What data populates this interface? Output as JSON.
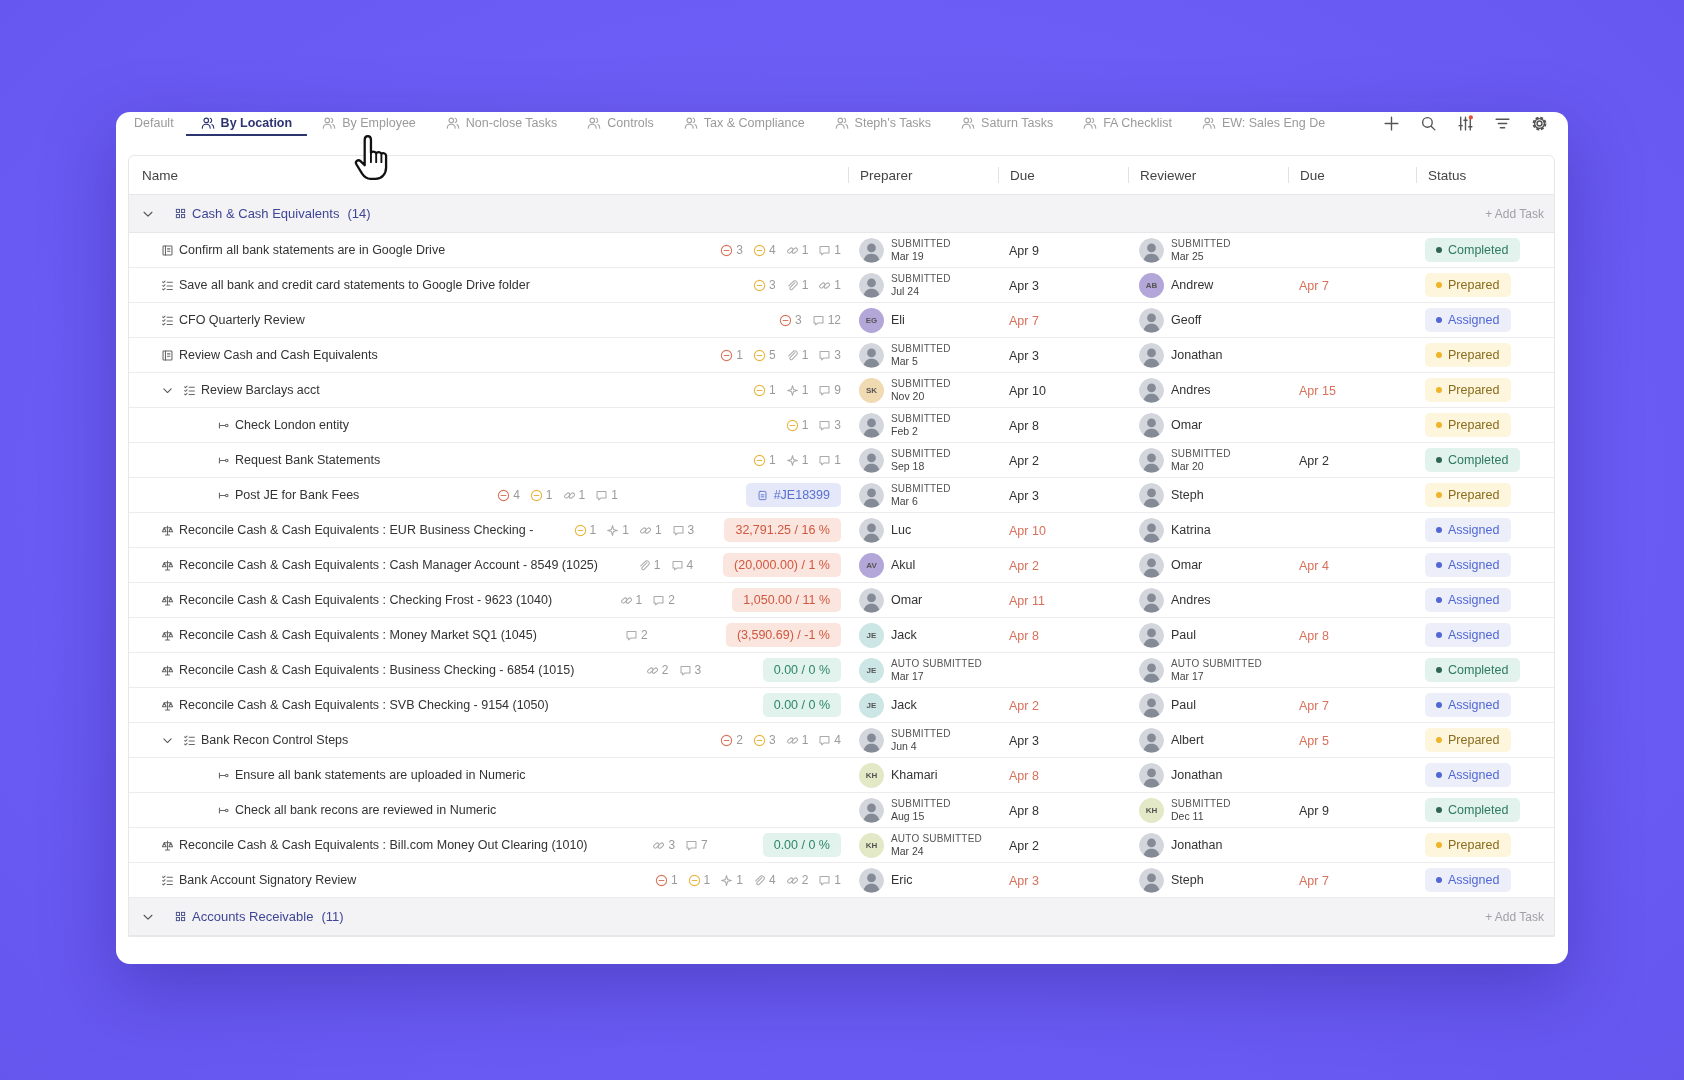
{
  "tabs": [
    {
      "label": "Default",
      "kind": "plain",
      "selected": false
    },
    {
      "label": "By Location",
      "kind": "grouped",
      "selected": true
    },
    {
      "label": "By Employee",
      "kind": "grouped",
      "selected": false
    },
    {
      "label": "Non-close Tasks",
      "kind": "grouped",
      "selected": false
    },
    {
      "label": "Controls",
      "kind": "grouped",
      "selected": false
    },
    {
      "label": "Tax & Compliance",
      "kind": "grouped",
      "selected": false
    },
    {
      "label": "Steph's Tasks",
      "kind": "grouped",
      "selected": false
    },
    {
      "label": "Saturn Tasks",
      "kind": "grouped",
      "selected": false
    },
    {
      "label": "FA Checklist",
      "kind": "grouped",
      "selected": false
    },
    {
      "label": "EW: Sales Eng De",
      "kind": "grouped",
      "selected": false
    }
  ],
  "table": {
    "columns": [
      "Name",
      "Preparer",
      "Due",
      "Reviewer",
      "Due",
      "Status"
    ],
    "groups": [
      {
        "name": "Cash & Cash Equivalents",
        "count": "(14)",
        "expanded": true,
        "add_label": "+ Add Task",
        "rows": [
          {
            "kind": "document",
            "name": "Confirm all bank statements are in Google Drive",
            "badges": [
              {
                "kind": "blocker",
                "count": "3"
              },
              {
                "kind": "warning",
                "count": "4"
              },
              {
                "kind": "link",
                "count": "1"
              },
              {
                "kind": "comment",
                "count": "1"
              }
            ],
            "preparer": {
              "avatar": {
                "kind": "photo"
              },
              "note": "SUBMITTED",
              "date": "Mar 19"
            },
            "preparer_due": {
              "text": "Apr 9",
              "overdue": false
            },
            "reviewer": {
              "avatar": {
                "kind": "photo"
              },
              "note": "SUBMITTED",
              "date": "Mar 25"
            },
            "status": {
              "kind": "completed",
              "label": "Completed"
            }
          },
          {
            "kind": "checklist",
            "name": "Save all bank and credit card statements to Google Drive folder",
            "badges": [
              {
                "kind": "warning",
                "count": "3"
              },
              {
                "kind": "attachment",
                "count": "1"
              },
              {
                "kind": "link",
                "count": "1"
              }
            ],
            "preparer": {
              "avatar": {
                "kind": "photo"
              },
              "note": "SUBMITTED",
              "date": "Jul 24"
            },
            "preparer_due": {
              "text": "Apr 3",
              "overdue": false
            },
            "reviewer": {
              "avatar": {
                "kind": "initials",
                "initials": "AB",
                "color": "#b3a6d8"
              },
              "name": "Andrew"
            },
            "reviewer_due": {
              "text": "Apr 7",
              "overdue": true
            },
            "status": {
              "kind": "prepared",
              "label": "Prepared"
            }
          },
          {
            "kind": "checklist",
            "name": "CFO Quarterly Review",
            "badges": [
              {
                "kind": "blocker",
                "count": "3"
              },
              {
                "kind": "comment",
                "count": "12"
              }
            ],
            "preparer": {
              "avatar": {
                "kind": "initials",
                "initials": "EG",
                "color": "#b3a6d8"
              },
              "name": "Eli"
            },
            "preparer_due": {
              "text": "Apr 7",
              "overdue": true
            },
            "reviewer": {
              "avatar": {
                "kind": "photo"
              },
              "name": "Geoff"
            },
            "status": {
              "kind": "assigned",
              "label": "Assigned"
            }
          },
          {
            "kind": "document",
            "name": "Review Cash and Cash Equivalents",
            "badges": [
              {
                "kind": "blocker",
                "count": "1"
              },
              {
                "kind": "warning",
                "count": "5"
              },
              {
                "kind": "attachment",
                "count": "1"
              },
              {
                "kind": "comment",
                "count": "3"
              }
            ],
            "preparer": {
              "avatar": {
                "kind": "photo"
              },
              "note": "SUBMITTED",
              "date": "Mar 5"
            },
            "preparer_due": {
              "text": "Apr 3",
              "overdue": false
            },
            "reviewer": {
              "avatar": {
                "kind": "photo"
              },
              "name": "Jonathan"
            },
            "status": {
              "kind": "prepared",
              "label": "Prepared"
            }
          },
          {
            "kind": "checklist",
            "expanded": true,
            "name": "Review Barclays acct",
            "badges": [
              {
                "kind": "warning",
                "count": "1"
              },
              {
                "kind": "spark",
                "count": "1"
              },
              {
                "kind": "comment",
                "count": "9"
              }
            ],
            "preparer": {
              "avatar": {
                "kind": "initials",
                "initials": "SK",
                "color": "#f0dab2"
              },
              "note": "SUBMITTED",
              "date": "Nov 20"
            },
            "preparer_due": {
              "text": "Apr 10",
              "overdue": false
            },
            "reviewer": {
              "avatar": {
                "kind": "photo"
              },
              "name": "Andres"
            },
            "reviewer_due": {
              "text": "Apr 15",
              "overdue": true
            },
            "status": {
              "kind": "prepared",
              "label": "Prepared"
            },
            "children": [
              {
                "kind": "step",
                "name": "Check London entity",
                "badges": [
                  {
                    "kind": "warning",
                    "count": "1"
                  },
                  {
                    "kind": "comment",
                    "count": "3"
                  }
                ],
                "preparer": {
                  "avatar": {
                    "kind": "photo"
                  },
                  "note": "SUBMITTED",
                  "date": "Feb 2"
                },
                "preparer_due": {
                  "text": "Apr 8",
                  "overdue": false
                },
                "reviewer": {
                  "avatar": {
                    "kind": "photo"
                  },
                  "name": "Omar"
                },
                "status": {
                  "kind": "prepared",
                  "label": "Prepared"
                }
              },
              {
                "kind": "step",
                "name": "Request Bank Statements",
                "badges": [
                  {
                    "kind": "warning",
                    "count": "1"
                  },
                  {
                    "kind": "spark",
                    "count": "1"
                  },
                  {
                    "kind": "comment",
                    "count": "1"
                  }
                ],
                "preparer": {
                  "avatar": {
                    "kind": "photo"
                  },
                  "note": "SUBMITTED",
                  "date": "Sep 18"
                },
                "preparer_due": {
                  "text": "Apr 2",
                  "overdue": false
                },
                "reviewer": {
                  "avatar": {
                    "kind": "photo"
                  },
                  "note": "SUBMITTED",
                  "date": "Mar 20"
                },
                "reviewer_due": {
                  "text": "Apr 2",
                  "overdue": false
                },
                "status": {
                  "kind": "completed",
                  "label": "Completed"
                }
              },
              {
                "kind": "step",
                "name": "Post JE for Bank Fees",
                "badges": [
                  {
                    "kind": "blocker",
                    "count": "4"
                  },
                  {
                    "kind": "warning",
                    "count": "1"
                  },
                  {
                    "kind": "link",
                    "count": "1"
                  },
                  {
                    "kind": "comment",
                    "count": "1"
                  }
                ],
                "amount": {
                  "kind": "journal",
                  "text": "#JE18399"
                },
                "preparer": {
                  "avatar": {
                    "kind": "photo"
                  },
                  "note": "SUBMITTED",
                  "date": "Mar 6"
                },
                "preparer_due": {
                  "text": "Apr 3",
                  "overdue": false
                },
                "reviewer": {
                  "avatar": {
                    "kind": "photo"
                  },
                  "name": "Steph"
                },
                "status": {
                  "kind": "prepared",
                  "label": "Prepared"
                }
              }
            ]
          },
          {
            "kind": "reconciliation",
            "name": "Reconcile Cash & Cash Equivalents : EUR Business Checking -",
            "badges": [
              {
                "kind": "warning",
                "count": "1"
              },
              {
                "kind": "spark",
                "count": "1"
              },
              {
                "kind": "link",
                "count": "1"
              },
              {
                "kind": "comment",
                "count": "3"
              }
            ],
            "amount": {
              "kind": "variance",
              "text": "32,791.25 / 16 %"
            },
            "preparer": {
              "avatar": {
                "kind": "photo"
              },
              "name": "Luc"
            },
            "preparer_due": {
              "text": "Apr 10",
              "overdue": true
            },
            "reviewer": {
              "avatar": {
                "kind": "photo"
              },
              "name": "Katrina"
            },
            "status": {
              "kind": "assigned",
              "label": "Assigned"
            }
          },
          {
            "kind": "reconciliation",
            "name": "Reconcile Cash & Cash Equivalents : Cash Manager Account - 8549 (1025)",
            "badges": [
              {
                "kind": "attachment",
                "count": "1"
              },
              {
                "kind": "comment",
                "count": "4"
              }
            ],
            "amount": {
              "kind": "variance",
              "text": "(20,000.00) / 1 %"
            },
            "preparer": {
              "avatar": {
                "kind": "initials",
                "initials": "AV",
                "color": "#b3a6d8"
              },
              "name": "Akul"
            },
            "preparer_due": {
              "text": "Apr 2",
              "overdue": true
            },
            "reviewer": {
              "avatar": {
                "kind": "photo"
              },
              "name": "Omar"
            },
            "reviewer_due": {
              "text": "Apr 4",
              "overdue": true
            },
            "status": {
              "kind": "assigned",
              "label": "Assigned"
            }
          },
          {
            "kind": "reconciliation",
            "name": "Reconcile Cash & Cash Equivalents : Checking Frost - 9623 (1040)",
            "badges": [
              {
                "kind": "link",
                "count": "1"
              },
              {
                "kind": "comment",
                "count": "2"
              }
            ],
            "amount": {
              "kind": "variance",
              "text": "1,050.00 / 11 %"
            },
            "preparer": {
              "avatar": {
                "kind": "photo"
              },
              "name": "Omar"
            },
            "preparer_due": {
              "text": "Apr 11",
              "overdue": true
            },
            "reviewer": {
              "avatar": {
                "kind": "photo"
              },
              "name": "Andres"
            },
            "status": {
              "kind": "assigned",
              "label": "Assigned"
            }
          },
          {
            "kind": "reconciliation",
            "name": "Reconcile Cash & Cash Equivalents : Money Market SQ1 (1045)",
            "badges": [
              {
                "kind": "comment",
                "count": "2"
              }
            ],
            "amount": {
              "kind": "variance",
              "text": "(3,590.69) / -1 %"
            },
            "preparer": {
              "avatar": {
                "kind": "initials",
                "initials": "JE",
                "color": "#cbe6e4"
              },
              "name": "Jack"
            },
            "preparer_due": {
              "text": "Apr 8",
              "overdue": true
            },
            "reviewer": {
              "avatar": {
                "kind": "photo"
              },
              "name": "Paul"
            },
            "reviewer_due": {
              "text": "Apr 8",
              "overdue": true
            },
            "status": {
              "kind": "assigned",
              "label": "Assigned"
            }
          },
          {
            "kind": "reconciliation",
            "name": "Reconcile Cash & Cash Equivalents : Business Checking - 6854 (1015)",
            "badges": [
              {
                "kind": "link",
                "count": "2"
              },
              {
                "kind": "comment",
                "count": "3"
              }
            ],
            "amount": {
              "kind": "balanced",
              "text": "0.00 / 0 %"
            },
            "preparer": {
              "avatar": {
                "kind": "initials",
                "initials": "JE",
                "color": "#cbe6e4"
              },
              "note": "AUTO SUBMITTED",
              "date": "Mar 17"
            },
            "reviewer": {
              "avatar": {
                "kind": "photo"
              },
              "note": "AUTO SUBMITTED",
              "date": "Mar 17"
            },
            "status": {
              "kind": "completed",
              "label": "Completed"
            }
          },
          {
            "kind": "reconciliation",
            "name": "Reconcile Cash & Cash Equivalents : SVB Checking - 9154 (1050)",
            "amount": {
              "kind": "balanced",
              "text": "0.00 / 0 %"
            },
            "preparer": {
              "avatar": {
                "kind": "initials",
                "initials": "JE",
                "color": "#cbe6e4"
              },
              "name": "Jack"
            },
            "preparer_due": {
              "text": "Apr 2",
              "overdue": true
            },
            "reviewer": {
              "avatar": {
                "kind": "photo"
              },
              "name": "Paul"
            },
            "reviewer_due": {
              "text": "Apr 7",
              "overdue": true
            },
            "status": {
              "kind": "assigned",
              "label": "Assigned"
            }
          },
          {
            "kind": "checklist",
            "expanded": true,
            "name": "Bank Recon Control Steps",
            "badges": [
              {
                "kind": "blocker",
                "count": "2"
              },
              {
                "kind": "warning",
                "count": "3"
              },
              {
                "kind": "link",
                "count": "1"
              },
              {
                "kind": "comment",
                "count": "4"
              }
            ],
            "preparer": {
              "avatar": {
                "kind": "photo"
              },
              "note": "SUBMITTED",
              "date": "Jun 4"
            },
            "preparer_due": {
              "text": "Apr 3",
              "overdue": false
            },
            "reviewer": {
              "avatar": {
                "kind": "photo"
              },
              "name": "Albert"
            },
            "reviewer_due": {
              "text": "Apr 5",
              "overdue": true
            },
            "status": {
              "kind": "prepared",
              "label": "Prepared"
            },
            "children": [
              {
                "kind": "step",
                "name": "Ensure all bank statements are uploaded in Numeric",
                "preparer": {
                  "avatar": {
                    "kind": "initials",
                    "initials": "KH",
                    "color": "#e3e8c6"
                  },
                  "name": "Khamari"
                },
                "preparer_due": {
                  "text": "Apr 8",
                  "overdue": true
                },
                "reviewer": {
                  "avatar": {
                    "kind": "photo"
                  },
                  "name": "Jonathan"
                },
                "status": {
                  "kind": "assigned",
                  "label": "Assigned"
                }
              },
              {
                "kind": "step",
                "name": "Check all bank recons are reviewed in Numeric",
                "preparer": {
                  "avatar": {
                    "kind": "photo"
                  },
                  "note": "SUBMITTED",
                  "date": "Aug 15"
                },
                "preparer_due": {
                  "text": "Apr 8",
                  "overdue": false
                },
                "reviewer": {
                  "avatar": {
                    "kind": "initials",
                    "initials": "KH",
                    "color": "#e3e8c6"
                  },
                  "note": "SUBMITTED",
                  "date": "Dec 11"
                },
                "reviewer_due": {
                  "text": "Apr 9",
                  "overdue": false
                },
                "status": {
                  "kind": "completed",
                  "label": "Completed"
                }
              }
            ]
          },
          {
            "kind": "reconciliation",
            "name": "Reconcile Cash & Cash Equivalents : Bill.com Money Out Clearing (1010)",
            "badges": [
              {
                "kind": "link",
                "count": "3"
              },
              {
                "kind": "comment",
                "count": "7"
              }
            ],
            "amount": {
              "kind": "balanced",
              "text": "0.00 / 0 %"
            },
            "preparer": {
              "avatar": {
                "kind": "initials",
                "initials": "KH",
                "color": "#e3e8c6"
              },
              "note": "AUTO SUBMITTED",
              "date": "Mar 24"
            },
            "preparer_due": {
              "text": "Apr 2",
              "overdue": false
            },
            "reviewer": {
              "avatar": {
                "kind": "photo"
              },
              "name": "Jonathan"
            },
            "status": {
              "kind": "prepared",
              "label": "Prepared"
            }
          },
          {
            "kind": "checklist",
            "name": "Bank Account Signatory Review",
            "badges": [
              {
                "kind": "blocker",
                "count": "1"
              },
              {
                "kind": "warning",
                "count": "1"
              },
              {
                "kind": "spark",
                "count": "1"
              },
              {
                "kind": "attachment",
                "count": "4"
              },
              {
                "kind": "link",
                "count": "2"
              },
              {
                "kind": "comment",
                "count": "1"
              }
            ],
            "preparer": {
              "avatar": {
                "kind": "photo"
              },
              "name": "Eric"
            },
            "preparer_due": {
              "text": "Apr 3",
              "overdue": true
            },
            "reviewer": {
              "avatar": {
                "kind": "photo"
              },
              "name": "Steph"
            },
            "reviewer_due": {
              "text": "Apr 7",
              "overdue": true
            },
            "status": {
              "kind": "assigned",
              "label": "Assigned"
            }
          }
        ]
      },
      {
        "name": "Accounts Receivable",
        "count": "(11)",
        "expanded": true,
        "add_label": "+ Add Task"
      }
    ]
  }
}
